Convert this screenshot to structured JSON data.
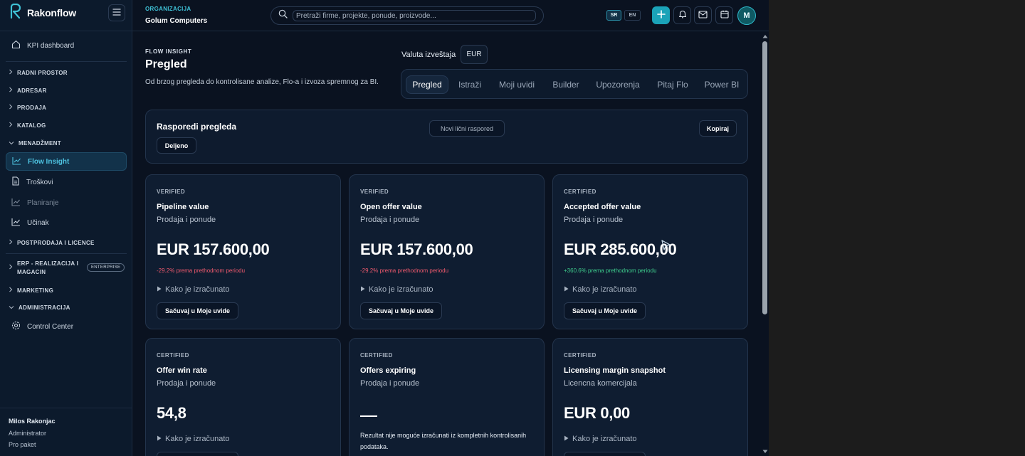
{
  "app": {
    "brand": "Rakonflow",
    "colors": {
      "accent": "#1ba3b8",
      "bg": "#0a1220",
      "sidebar": "#0c1a2c",
      "positive": "#3fcf8e",
      "negative": "#f05a6e"
    }
  },
  "sidebar": {
    "kpi": "KPI dashboard",
    "radni_prostor": "RADNI PROSTOR",
    "adresar": "ADRESAR",
    "prodaja": "PRODAJA",
    "katalog": "KATALOG",
    "menadzment": "MENADŽMENT",
    "flow_insight": "Flow Insight",
    "troskovi": "Troškovi",
    "planiranje": "Planiranje",
    "ucinak": "Učinak",
    "postprodaja": "POSTPRODAJA I LICENCE",
    "erp_line1": "ERP - REALIZACIJA I",
    "erp_line2": "MAGACIN",
    "erp_badge": "ENTERPRISE",
    "marketing": "MARKETING",
    "administracija": "ADMINISTRACIJA",
    "control_center": "Control Center",
    "user": {
      "name": "Milos Rakonjac",
      "role": "Administrator",
      "plan": "Pro paket"
    }
  },
  "topbar": {
    "org_label": "ORGANIZACIJA",
    "org_name": "Golum Computers",
    "search_placeholder": "Pretraži firme, projekte, ponude, proizvode...",
    "lang_sr": "SR",
    "lang_en": "EN",
    "avatar_initial": "M"
  },
  "page": {
    "eyebrow": "FLOW INSIGHT",
    "title": "Pregled",
    "description": "Od brzog pregleda do kontrolisane analize, Flo-a i izvoza spremnog za BI.",
    "currency_label": "Valuta izveštaja",
    "currency_value": "EUR",
    "tabs": [
      "Pregled",
      "Istraži",
      "Moji uvidi",
      "Builder",
      "Upozorenja",
      "Pitaj Flo",
      "Power BI"
    ]
  },
  "layouts": {
    "title": "Rasporedi pregleda",
    "shared": "Deljeno",
    "new_layout": "Novi lični raspored",
    "copy": "Kopiraj"
  },
  "cards": [
    {
      "tag": "VERIFIED",
      "title": "Pipeline value",
      "subtitle": "Prodaja i ponude",
      "value": "EUR 157.600,00",
      "delta": "-29.2% prema prethodnom periodu",
      "how": "Kako je izračunato",
      "save": "Sačuvaj u Moje uvide"
    },
    {
      "tag": "VERIFIED",
      "title": "Open offer value",
      "subtitle": "Prodaja i ponude",
      "value": "EUR 157.600,00",
      "delta": "-29.2% prema prethodnom periodu",
      "how": "Kako je izračunato",
      "save": "Sačuvaj u Moje uvide"
    },
    {
      "tag": "CERTIFIED",
      "title": "Accepted offer value",
      "subtitle": "Prodaja i ponude",
      "value": "EUR 285.600,00",
      "delta": "+360.6% prema prethodnom periodu",
      "how": "Kako je izračunato",
      "save": "Sačuvaj u Moje uvide"
    },
    {
      "tag": "CERTIFIED",
      "title": "Offer win rate",
      "subtitle": "Prodaja i ponude",
      "value": "54,8",
      "how": "Kako je izračunato"
    },
    {
      "tag": "CERTIFIED",
      "title": "Offers expiring",
      "subtitle": "Prodaja i ponude",
      "note": "Rezultat nije moguće izračunati iz kompletnih kontrolisanih podataka."
    },
    {
      "tag": "CERTIFIED",
      "title": "Licensing margin snapshot",
      "subtitle": "Licencna komercijala",
      "value": "EUR 0,00",
      "how": "Kako je izračunato"
    }
  ]
}
